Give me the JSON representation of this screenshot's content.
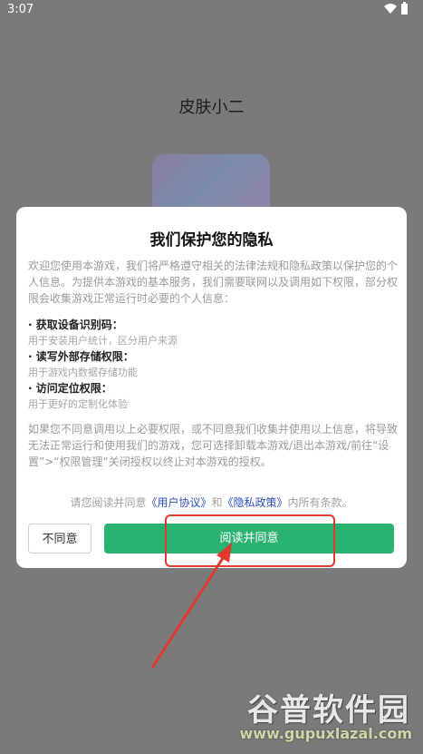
{
  "status_bar": {
    "time": "3:07",
    "icons": "▾ ▮"
  },
  "app": {
    "title": "皮肤小二"
  },
  "dialog": {
    "title": "我们保护您的隐私",
    "intro": "欢迎您使用本游戏，我们将严格遵守相关的法律法规和隐私政策以保护您的个人信息。为提供本游戏的基本服务，我们需要联网以及调用如下权限，部分权限会收集游戏正常运行时必要的个人信息：",
    "permissions": [
      {
        "title": "· 获取设备识别码：",
        "desc": "用于安装用户统计，区分用户来源"
      },
      {
        "title": "· 读写外部存储权限：",
        "desc": "用于游戏内数据存储功能"
      },
      {
        "title": "· 访问定位权限：",
        "desc": "用于更好的定制化体验"
      }
    ],
    "refuse_note": "如果您不同意调用以上必要权限，或不同意我们收集并使用以上信息，将导致无法正常运行和使用我们的游戏，您可选择卸载本游戏/退出本游戏/前往“设置”>“权限管理”关闭授权以终止对本游戏的授权。",
    "agree_prefix": "请您阅读并同意",
    "user_agreement_link": "《用户协议》",
    "and_word": "和",
    "privacy_policy_link": "《隐私政策》",
    "agree_suffix": "内所有条款。",
    "disagree_button": "不同意",
    "agree_button": "阅读并同意"
  },
  "watermark": {
    "brand": "谷普软件园",
    "url": "www.gupuxlazal.com"
  },
  "colors": {
    "accent_green": "#2ab271",
    "link_blue": "#2c4fb5",
    "highlight_red": "#e03a2e"
  }
}
